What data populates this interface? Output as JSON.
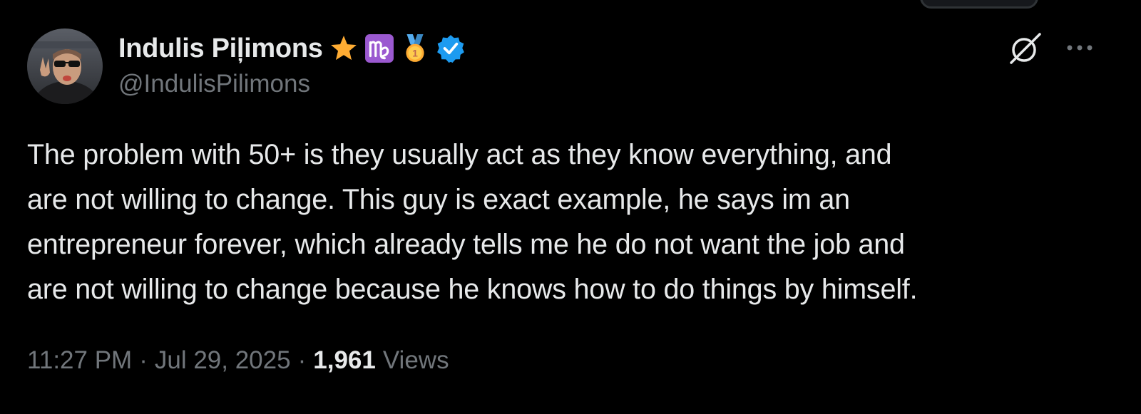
{
  "tweet": {
    "author": {
      "display_name": "Indulis Piļimons",
      "handle": "@IndulisPilimons",
      "badges": [
        "star-emoji",
        "virgo-emoji",
        "first-place-medal-emoji",
        "verified-badge"
      ]
    },
    "text": "The problem with 50+ is they usually act as they know everything, and\nare not willing to change. This guy is exact example, he says im an\nentrepreneur forever, which already tells me he do not want the job and\nare not willing to change because he knows how to do things by himself.",
    "time": "11:27 PM",
    "date": "Jul 29, 2025",
    "separator": "·",
    "views_count": "1,961",
    "views_label": "Views"
  },
  "colors": {
    "background": "#000000",
    "primary_text": "#e7e9ea",
    "secondary_text": "#71767b",
    "verified": "#1d9bf0"
  }
}
